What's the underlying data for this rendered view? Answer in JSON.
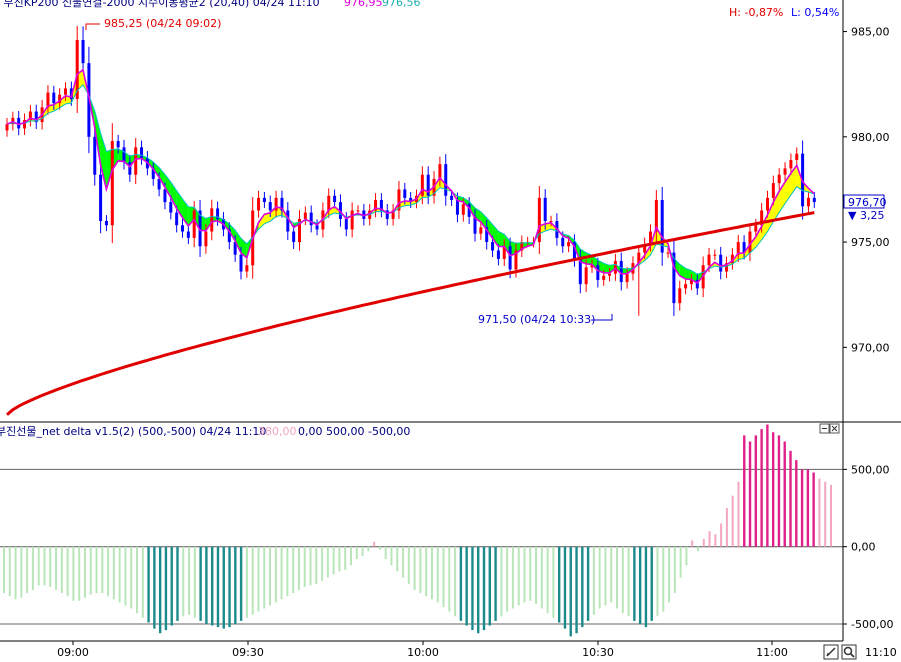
{
  "price_panel": {
    "header_left": "- 부진KP200 선물연결-2000 지수이동평균2  (20,40)  04/24  11:10",
    "header_ma1": "976,95",
    "header_ma2": "976,56",
    "high_change": "H: -0,87%",
    "low_change": "L: 0,54%",
    "high_label": "985,25 (04/24 09:02)",
    "low_label": "971,50 (04/24 10:33)",
    "last_price_label": "976,70",
    "change_label": "▼ 3,25",
    "colors": {
      "up": "#ff0000",
      "down": "#0000ff",
      "band_up": "#ffff00",
      "band_down": "#00ff00",
      "ma_fast": "#dd00dd",
      "ma_slow": "#e00000"
    }
  },
  "indicator_panel": {
    "header_left": "부진선물_net delta v1.5(2)  (500,-500)  04/24  11:10",
    "header_value": "380,00",
    "header_rest": "0,00  500,00  -500,00",
    "colors": {
      "strong_pos": "#e0218a",
      "weak_pos": "#f4a6bf",
      "weak_neg": "#b8e6b8",
      "strong_neg": "#1a8a8a"
    },
    "reference_levels": [
      500,
      0,
      -500
    ]
  },
  "time_axis": {
    "labels": [
      "09:00",
      "09:30",
      "10:00",
      "10:30",
      "11:00"
    ],
    "clock": "11:10"
  },
  "toolbar": {
    "close_label": "×",
    "min_label": "−"
  },
  "chart_data": [
    {
      "type": "candlestick",
      "title": "",
      "ylim": [
        966.5,
        986.5
      ],
      "y_ticks": [
        "985,00",
        "980,00",
        "975,00",
        "970,00"
      ],
      "y_tick_values": [
        985,
        980,
        975,
        970
      ],
      "x_ticks": [
        "09:00",
        "09:30",
        "10:00",
        "10:30",
        "11:00"
      ],
      "candle_count": 139,
      "close": [
        980.6,
        980.9,
        980.4,
        980.8,
        981.2,
        980.7,
        981.4,
        982.1,
        981.6,
        982.0,
        982.3,
        981.8,
        984.6,
        983.5,
        980.0,
        978.2,
        976.0,
        975.8,
        979.8,
        979.5,
        978.8,
        978.2,
        979.5,
        979.0,
        978.5,
        978.0,
        977.5,
        976.9,
        976.4,
        975.8,
        975.5,
        975.2,
        976.5,
        974.8,
        975.5,
        976.6,
        976.1,
        975.6,
        975.0,
        974.4,
        973.6,
        973.9,
        976.5,
        977.1,
        976.9,
        976.5,
        977.1,
        976.5,
        975.5,
        975.0,
        976.1,
        976.4,
        975.8,
        975.6,
        976.5,
        977.2,
        976.9,
        976.1,
        975.6,
        976.5,
        976.5,
        976.1,
        976.5,
        977.0,
        976.5,
        976.1,
        976.5,
        977.5,
        977.1,
        976.9,
        977.2,
        978.2,
        977.2,
        978.0,
        978.7,
        977.2,
        977.0,
        976.3,
        976.8,
        976.2,
        975.4,
        975.7,
        975.0,
        974.6,
        974.2,
        974.8,
        973.7,
        974.6,
        975.0,
        975.0,
        975.0,
        977.1,
        976.0,
        976.0,
        975.2,
        974.8,
        975.0,
        974.2,
        973.0,
        973.8,
        973.9,
        973.2,
        973.4,
        973.5,
        974.1,
        973.1,
        973.5,
        974.0,
        974.5,
        974.9,
        975.5,
        977.0,
        974.5,
        974.5,
        972.1,
        972.8,
        973.0,
        973.2,
        972.8,
        973.9,
        974.4,
        974.4,
        973.6,
        974.0,
        974.4,
        975.0,
        974.5,
        975.5,
        975.8,
        976.5,
        977.1,
        977.8,
        978.2,
        978.5,
        978.9,
        979.2,
        976.7,
        977.1,
        976.9
      ],
      "high_label": "985,25 (04/24 09:02)",
      "low_label": "971,50 (04/24 10:33)",
      "last": "976,70",
      "change": "▼ 3,25",
      "series": [
        {
          "name": "976,95",
          "role": "ma_fast"
        },
        {
          "name": "976,56",
          "role": "ma_slow"
        }
      ]
    },
    {
      "type": "bar",
      "title": "",
      "ylim": [
        -610,
        800
      ],
      "y_ticks": [
        "500,00",
        "0,00",
        "-500,00"
      ],
      "y_tick_values": [
        500,
        0,
        -500
      ],
      "reference_levels": [
        500,
        0,
        -500
      ],
      "strong_threshold": 470,
      "values": [
        -300,
        -320,
        -340,
        -330,
        -300,
        -280,
        -250,
        -250,
        -260,
        -280,
        -300,
        -320,
        -350,
        -350,
        -330,
        -310,
        -300,
        -300,
        -320,
        -340,
        -360,
        -380,
        -400,
        -430,
        -460,
        -490,
        -530,
        -560,
        -540,
        -510,
        -480,
        -450,
        -440,
        -460,
        -480,
        -500,
        -510,
        -520,
        -530,
        -520,
        -500,
        -480,
        -460,
        -440,
        -420,
        -400,
        -380,
        -360,
        -340,
        -320,
        -300,
        -280,
        -260,
        -250,
        -240,
        -220,
        -200,
        -180,
        -160,
        -150,
        -120,
        -80,
        -60,
        -30,
        30,
        -20,
        -80,
        -120,
        -160,
        -200,
        -240,
        -280,
        -300,
        -320,
        -340,
        -360,
        -390,
        -420,
        -450,
        -480,
        -510,
        -540,
        -560,
        -540,
        -510,
        -480,
        -450,
        -420,
        -400,
        -380,
        -360,
        -350,
        -370,
        -400,
        -430,
        -460,
        -490,
        -530,
        -580,
        -560,
        -520,
        -480,
        -440,
        -400,
        -380,
        -360,
        -400,
        -430,
        -450,
        -480,
        -500,
        -520,
        -480,
        -450,
        -420,
        -360,
        -300,
        -200,
        -120,
        40,
        -30,
        50,
        100,
        80,
        150,
        250,
        330,
        420,
        720,
        680,
        720,
        760,
        790,
        740,
        720,
        680,
        620,
        560,
        500,
        500,
        480,
        440,
        420,
        400
      ],
      "threshold_note": "reference 500"
    }
  ]
}
